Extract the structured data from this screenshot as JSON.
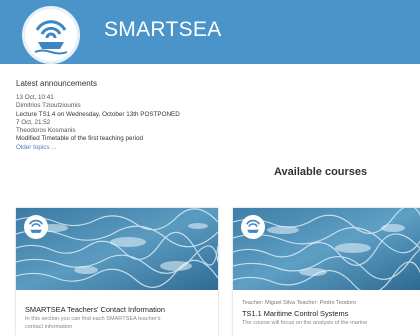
{
  "header": {
    "brand": "SMARTSEA",
    "logo_icon": "smartsea-wifi-ship-logo",
    "background_color": "#4a94c9"
  },
  "announcements": {
    "heading": "Latest announcements",
    "items": [
      {
        "date": "13 Oct, 10:41",
        "author": "Dimitrios Tzioutzioumis",
        "title": "Lecture TS1.4 on Wednesday, October 13th POSTPONED"
      },
      {
        "date": "7 Oct, 21:52",
        "author": "Theodoros Kosmanis",
        "title": "Modified Timetable of the first teaching period"
      }
    ],
    "older_link": "Older topics ..."
  },
  "courses": {
    "heading": "Available courses",
    "items": [
      {
        "title": "SMARTSEA Teachers' Contact Information",
        "description": "In this section you can find each SMARTSEA teacher's",
        "description2": "contact information"
      },
      {
        "teachers": "Teacher: Miguel Silva   Teacher: Pedro Teodoro",
        "title": "TS1.1 Maritime Control Systems",
        "description": "The course will focus on the analysis of the marine"
      }
    ]
  }
}
